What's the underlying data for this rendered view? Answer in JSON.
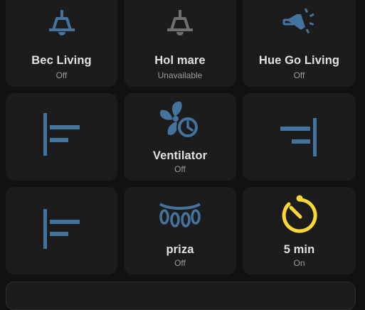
{
  "colors": {
    "page_bg": "#111111",
    "tile_bg": "#1c1c1c",
    "icon_on_blue": "#44739e",
    "icon_unavailable": "#6f6f6f",
    "icon_timer_yellow": "#fdd835",
    "name_text": "#e1e1e1",
    "state_text": "#9b9b9b"
  },
  "tiles": [
    {
      "name": "Bec Living",
      "state": "Off",
      "icon": "ceiling-light-icon"
    },
    {
      "name": "Hol mare",
      "state": "Unavailable",
      "icon": "ceiling-light-icon"
    },
    {
      "name": "Hue Go Living",
      "state": "Off",
      "icon": "hue-go-lamp-icon"
    },
    {
      "icon": "align-left-icon"
    },
    {
      "name": "Ventilator",
      "state": "Off",
      "icon": "fan-clock-icon"
    },
    {
      "icon": "align-right-icon"
    },
    {
      "icon": "align-left-icon"
    },
    {
      "name": "priza",
      "state": "Off",
      "icon": "chandelier-icon"
    },
    {
      "name": "5 min",
      "state": "On",
      "icon": "timer-icon"
    }
  ]
}
